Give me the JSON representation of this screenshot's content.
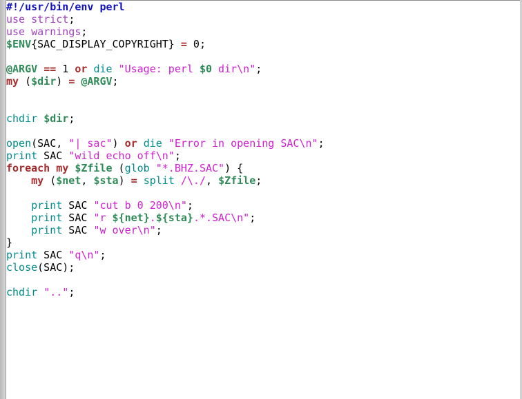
{
  "editor": {
    "colors": {
      "shebang": "#1010c0",
      "use": "#a040c0",
      "var": "#2e8b57",
      "kw": "#a52a2a",
      "builtin": "#008b8b",
      "str": "#d020d0"
    },
    "lines": [
      [
        [
          "shebang",
          "#!/usr/bin/env perl"
        ]
      ],
      [
        [
          "use",
          "use strict"
        ],
        [
          "plain",
          ";"
        ]
      ],
      [
        [
          "use",
          "use warnings"
        ],
        [
          "plain",
          ";"
        ]
      ],
      [
        [
          "var",
          "$ENV"
        ],
        [
          "plain",
          "{SAC_DISPLAY_COPYRIGHT} "
        ],
        [
          "kw",
          "="
        ],
        [
          "plain",
          " 0;"
        ]
      ],
      [],
      [
        [
          "var",
          "@ARGV"
        ],
        [
          "plain",
          " "
        ],
        [
          "kw",
          "=="
        ],
        [
          "plain",
          " 1 "
        ],
        [
          "kw",
          "or"
        ],
        [
          "plain",
          " "
        ],
        [
          "builtin",
          "die"
        ],
        [
          "plain",
          " "
        ],
        [
          "str",
          "\"Usage: perl "
        ],
        [
          "var",
          "$0"
        ],
        [
          "str",
          " dir\\n\""
        ],
        [
          "plain",
          ";"
        ]
      ],
      [
        [
          "kw",
          "my"
        ],
        [
          "plain",
          " ("
        ],
        [
          "var",
          "$dir"
        ],
        [
          "plain",
          ") "
        ],
        [
          "kw",
          "="
        ],
        [
          "plain",
          " "
        ],
        [
          "var",
          "@ARGV"
        ],
        [
          "plain",
          ";"
        ]
      ],
      [],
      [],
      [
        [
          "builtin",
          "chdir"
        ],
        [
          "plain",
          " "
        ],
        [
          "var",
          "$dir"
        ],
        [
          "plain",
          ";"
        ]
      ],
      [],
      [
        [
          "builtin",
          "open"
        ],
        [
          "plain",
          "(SAC, "
        ],
        [
          "str",
          "\"| sac\""
        ],
        [
          "plain",
          ") "
        ],
        [
          "kw",
          "or"
        ],
        [
          "plain",
          " "
        ],
        [
          "builtin",
          "die"
        ],
        [
          "plain",
          " "
        ],
        [
          "str",
          "\"Error in opening SAC\\n\""
        ],
        [
          "plain",
          ";"
        ]
      ],
      [
        [
          "builtin",
          "print"
        ],
        [
          "plain",
          " SAC "
        ],
        [
          "str",
          "\"wild echo off\\n\""
        ],
        [
          "plain",
          ";"
        ]
      ],
      [
        [
          "kw",
          "foreach"
        ],
        [
          "plain",
          " "
        ],
        [
          "kw",
          "my"
        ],
        [
          "plain",
          " "
        ],
        [
          "var",
          "$Zfile"
        ],
        [
          "plain",
          " ("
        ],
        [
          "builtin",
          "glob"
        ],
        [
          "plain",
          " "
        ],
        [
          "str",
          "\"*.BHZ.SAC\""
        ],
        [
          "plain",
          ") {"
        ]
      ],
      [
        [
          "plain",
          "    "
        ],
        [
          "kw",
          "my"
        ],
        [
          "plain",
          " ("
        ],
        [
          "var",
          "$net"
        ],
        [
          "plain",
          ", "
        ],
        [
          "var",
          "$sta"
        ],
        [
          "plain",
          ") "
        ],
        [
          "kw",
          "="
        ],
        [
          "plain",
          " "
        ],
        [
          "builtin",
          "split"
        ],
        [
          "plain",
          " "
        ],
        [
          "str",
          "/\\./"
        ],
        [
          "plain",
          ", "
        ],
        [
          "var",
          "$Zfile"
        ],
        [
          "plain",
          ";"
        ]
      ],
      [],
      [
        [
          "plain",
          "    "
        ],
        [
          "builtin",
          "print"
        ],
        [
          "plain",
          " SAC "
        ],
        [
          "str",
          "\"cut b 0 200\\n\""
        ],
        [
          "plain",
          ";"
        ]
      ],
      [
        [
          "plain",
          "    "
        ],
        [
          "builtin",
          "print"
        ],
        [
          "plain",
          " SAC "
        ],
        [
          "str",
          "\"r "
        ],
        [
          "var",
          "${net}"
        ],
        [
          "str",
          "."
        ],
        [
          "var",
          "${sta}"
        ],
        [
          "str",
          ".*.SAC\\n\""
        ],
        [
          "plain",
          ";"
        ]
      ],
      [
        [
          "plain",
          "    "
        ],
        [
          "builtin",
          "print"
        ],
        [
          "plain",
          " SAC "
        ],
        [
          "str",
          "\"w over\\n\""
        ],
        [
          "plain",
          ";"
        ]
      ],
      [
        [
          "plain",
          "}"
        ]
      ],
      [
        [
          "builtin",
          "print"
        ],
        [
          "plain",
          " SAC "
        ],
        [
          "str",
          "\"q\\n\""
        ],
        [
          "plain",
          ";"
        ]
      ],
      [
        [
          "builtin",
          "close"
        ],
        [
          "plain",
          "(SAC);"
        ]
      ],
      [],
      [
        [
          "builtin",
          "chdir"
        ],
        [
          "plain",
          " "
        ],
        [
          "str",
          "\"..\""
        ],
        [
          "plain",
          ";"
        ]
      ]
    ]
  }
}
